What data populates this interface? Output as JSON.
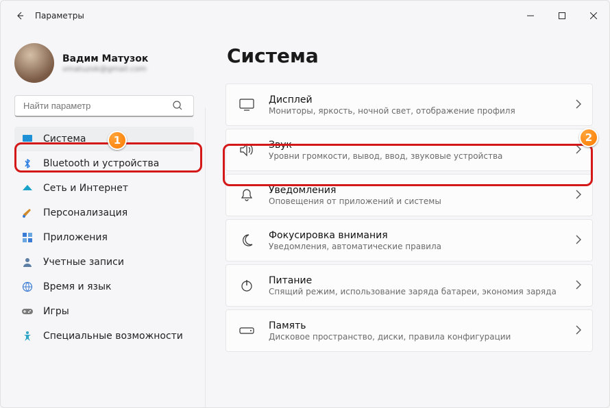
{
  "titlebar": {
    "app_name": "Параметры"
  },
  "user": {
    "name": "Вадим Матузок",
    "email_masked": "vmatuzok@gmail.com"
  },
  "search": {
    "placeholder": "Найти параметр"
  },
  "sidebar": {
    "items": [
      {
        "label": "Система",
        "icon": "display-icon",
        "selected": true
      },
      {
        "label": "Bluetooth и устройства",
        "icon": "bluetooth-icon"
      },
      {
        "label": "Сеть и Интернет",
        "icon": "wifi-icon"
      },
      {
        "label": "Персонализация",
        "icon": "brush-icon"
      },
      {
        "label": "Приложения",
        "icon": "apps-icon"
      },
      {
        "label": "Учетные записи",
        "icon": "account-icon"
      },
      {
        "label": "Время и язык",
        "icon": "globe-icon"
      },
      {
        "label": "Игры",
        "icon": "gamepad-icon"
      },
      {
        "label": "Специальные возможности",
        "icon": "accessibility-icon"
      }
    ]
  },
  "main": {
    "title": "Система",
    "cards": [
      {
        "icon": "monitor-icon",
        "title": "Дисплей",
        "sub": "Мониторы, яркость, ночной свет, отображение профиля"
      },
      {
        "icon": "sound-icon",
        "title": "Звук",
        "sub": "Уровни громкости, вывод, ввод, звуковые устройства"
      },
      {
        "icon": "bell-icon",
        "title": "Уведомления",
        "sub": "Оповещения от приложений и системы"
      },
      {
        "icon": "moon-icon",
        "title": "Фокусировка внимания",
        "sub": "Уведомления, автоматические правила"
      },
      {
        "icon": "power-icon",
        "title": "Питание",
        "sub": "Спящий режим, использование заряда батареи, экономия заряда"
      },
      {
        "icon": "storage-icon",
        "title": "Память",
        "sub": "Дисковое пространство, диски, правила конфигурации"
      }
    ]
  },
  "annotations": {
    "badge1": "1",
    "badge2": "2"
  }
}
